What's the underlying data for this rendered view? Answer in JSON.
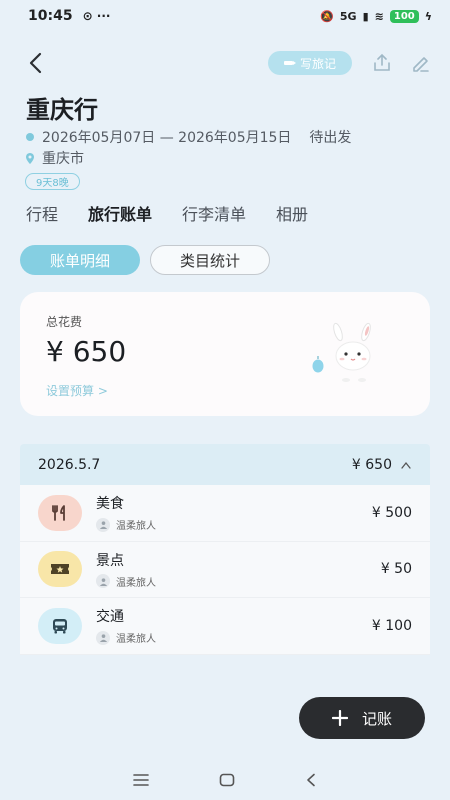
{
  "status": {
    "time": "10:45",
    "extra": "⊙ ···",
    "network": "5G",
    "battery": "100"
  },
  "header": {
    "write_label": "写旅记"
  },
  "trip": {
    "title": "重庆行",
    "dates": "2026年05月07日 — 2026年05月15日",
    "status": "待出发",
    "city": "重庆市",
    "duration": "9天8晚"
  },
  "tabs": [
    "行程",
    "旅行账单",
    "行李清单",
    "相册"
  ],
  "subtabs": [
    "账单明细",
    "类目统计"
  ],
  "summary": {
    "label": "总花费",
    "total": "¥ 650",
    "budget_link": "设置预算 >"
  },
  "day": {
    "date": "2026.5.7",
    "total": "¥ 650",
    "entries": [
      {
        "category": "美食",
        "user": "温柔旅人",
        "amount": "¥ 500",
        "icon": "utensils-icon",
        "color": "#f8d6cc"
      },
      {
        "category": "景点",
        "user": "温柔旅人",
        "amount": "¥ 50",
        "icon": "ticket-icon",
        "color": "#f8e6a8"
      },
      {
        "category": "交通",
        "user": "温柔旅人",
        "amount": "¥ 100",
        "icon": "bus-icon",
        "color": "#d3eef7"
      }
    ]
  },
  "fab": {
    "label": "记账"
  },
  "colors": {
    "accent": "#85cfe2",
    "background": "#e8f1f8",
    "fab": "#2a2c2f"
  }
}
